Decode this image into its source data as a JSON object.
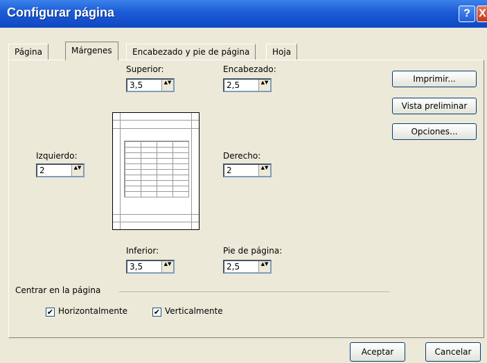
{
  "window": {
    "title": "Configurar página",
    "help_glyph": "?",
    "close_glyph": "X"
  },
  "tabs": [
    {
      "label": "Página"
    },
    {
      "label": "Márgenes"
    },
    {
      "label": "Encabezado y pie de página"
    },
    {
      "label": "Hoja"
    }
  ],
  "margins": {
    "top": {
      "label": "Superior:",
      "value": "3,5"
    },
    "header": {
      "label": "Encabezado:",
      "value": "2,5"
    },
    "left": {
      "label": "Izquierdo:",
      "value": "2"
    },
    "right": {
      "label": "Derecho:",
      "value": "2"
    },
    "bottom": {
      "label": "Inferior:",
      "value": "3,5"
    },
    "footer": {
      "label": "Pie de página:",
      "value": "2,5"
    }
  },
  "side_buttons": {
    "print": "Imprimir...",
    "preview": "Vista preliminar",
    "options": "Opciones..."
  },
  "center": {
    "section_label": "Centrar en la página",
    "horizontal": {
      "label": "Horizontalmente",
      "checked": true
    },
    "vertical": {
      "label": "Verticalmente",
      "checked": true
    }
  },
  "footer_buttons": {
    "ok": "Aceptar",
    "cancel": "Cancelar"
  },
  "glyphs": {
    "check": "✔",
    "spin": "▲▼"
  }
}
